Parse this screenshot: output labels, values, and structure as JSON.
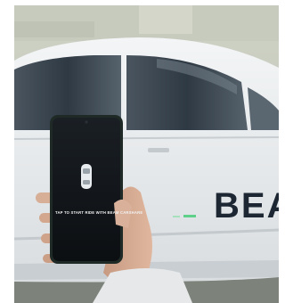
{
  "photo": {
    "phone_screen_text": "TAP TO START RIDE WITH BEAM CARSHARE",
    "car_branding_text": "BEA",
    "colors": {
      "car_body": "#e9ecef",
      "window_tint": "#3b4650",
      "phone_screen": "#111418",
      "phone_frame": "#1f2a26",
      "branding": "#1c2733",
      "accent_green": "#5fd08a"
    }
  }
}
